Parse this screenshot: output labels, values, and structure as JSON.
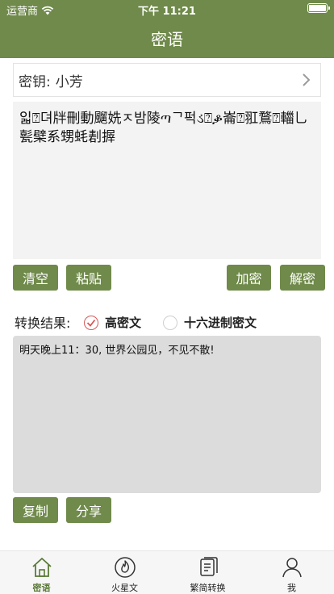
{
  "status_bar": {
    "carrier": "运营商",
    "time": "下午 11:21"
  },
  "nav": {
    "title": "密语"
  },
  "key": {
    "label": "密钥:",
    "value": "小芳"
  },
  "cipher_text": "읿⍰뎌牉刪動飀姺ㅈ밤陵ጣᄀ퍽ડ⍰ቇ崙⍰羾鶩⍰輺乚甏檗系甥蚝剨搱",
  "buttons": {
    "clear": "清空",
    "paste": "粘贴",
    "encrypt": "加密",
    "decrypt": "解密",
    "copy": "复制",
    "share": "分享"
  },
  "result": {
    "label": "转换结果:",
    "option_high": "高密文",
    "option_hex": "十六进制密文",
    "selected": "high",
    "text": "明天晚上11：30, 世界公园见，不见不散!"
  },
  "tabs": [
    {
      "label": "密语",
      "icon": "home-icon",
      "active": true
    },
    {
      "label": "火星文",
      "icon": "fire-icon",
      "active": false
    },
    {
      "label": "繁简转换",
      "icon": "document-icon",
      "active": false
    },
    {
      "label": "我",
      "icon": "user-icon",
      "active": false
    }
  ],
  "colors": {
    "primary": "#6f8a4a",
    "check": "#d65858",
    "tab_active": "#5b7a37"
  }
}
